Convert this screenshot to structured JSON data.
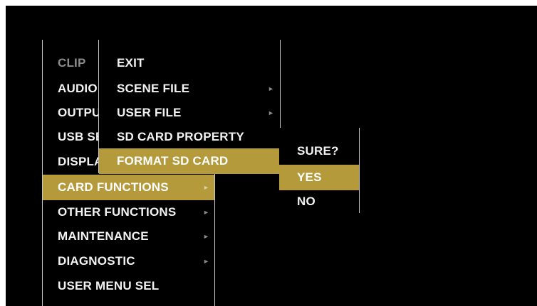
{
  "colors": {
    "background": "#000000",
    "text": "#f2f2f2",
    "dim_text": "#8c8c8c",
    "highlight": "#b59a3c",
    "border": "#c8c8c8"
  },
  "main_menu": {
    "items": [
      {
        "label": "CLIP",
        "state": "dim"
      },
      {
        "label": "AUDIO",
        "state": "normal"
      },
      {
        "label": "OUTPUT",
        "state": "normal"
      },
      {
        "label": "USB SETUP",
        "state": "normal"
      },
      {
        "label": "DISPLAY",
        "state": "normal"
      },
      {
        "label": "CARD FUNCTIONS",
        "state": "selected",
        "submenu_arrow": "►"
      },
      {
        "label": "OTHER FUNCTIONS",
        "state": "normal",
        "submenu_arrow": "►"
      },
      {
        "label": "MAINTENANCE",
        "state": "normal",
        "submenu_arrow": "►"
      },
      {
        "label": "DIAGNOSTIC",
        "state": "normal",
        "submenu_arrow": "►"
      },
      {
        "label": "USER MENU SEL",
        "state": "normal"
      }
    ]
  },
  "card_functions_menu": {
    "items": [
      {
        "label": "EXIT",
        "state": "normal"
      },
      {
        "label": "SCENE FILE",
        "state": "normal",
        "submenu_arrow": "►"
      },
      {
        "label": "USER FILE",
        "state": "normal",
        "submenu_arrow": "►"
      },
      {
        "label": "SD CARD PROPERTY",
        "state": "normal"
      },
      {
        "label": "FORMAT SD CARD",
        "state": "selected"
      }
    ]
  },
  "confirm_menu": {
    "title": "SURE?",
    "items": [
      {
        "label": "YES",
        "state": "selected"
      },
      {
        "label": "NO",
        "state": "normal"
      }
    ]
  }
}
